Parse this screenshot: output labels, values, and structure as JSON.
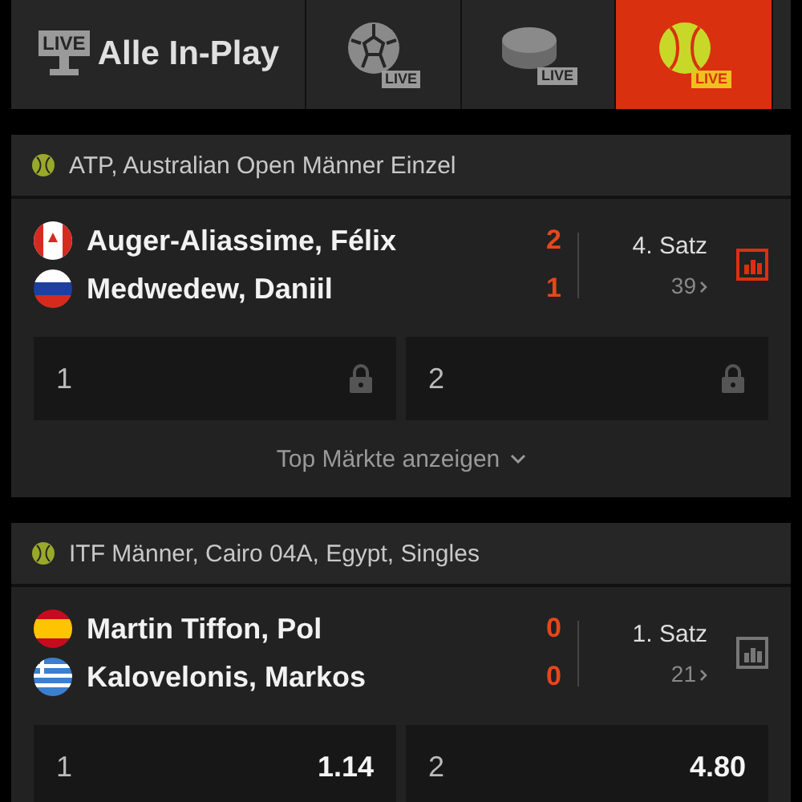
{
  "tabs": [
    {
      "kind": "all",
      "label": "Alle In-Play",
      "badge": "LIVE",
      "selected": false
    },
    {
      "kind": "soccer",
      "badge": "LIVE",
      "selected": false
    },
    {
      "kind": "hockey",
      "badge": "LIVE",
      "selected": false
    },
    {
      "kind": "tennis",
      "badge": "LIVE",
      "selected": true
    }
  ],
  "competitions": [
    {
      "title": "ATP, Australian Open Männer Einzel",
      "match": {
        "players": [
          {
            "kind": "ca",
            "name": "Auger-Aliassime, Félix",
            "score": "2"
          },
          {
            "kind": "ru",
            "name": "Medwedew, Daniil",
            "score": "1"
          }
        ],
        "period": "4. Satz",
        "markets": "39",
        "stats_highlighted": true,
        "odds": [
          {
            "label": "1",
            "locked": true
          },
          {
            "label": "2",
            "locked": true
          }
        ],
        "more": "Top Märkte anzeigen"
      }
    },
    {
      "title": "ITF Männer, Cairo 04A, Egypt, Singles",
      "match": {
        "players": [
          {
            "kind": "es",
            "name": "Martin Tiffon, Pol",
            "score": "0"
          },
          {
            "kind": "gr",
            "name": "Kalovelonis, Markos",
            "score": "0"
          }
        ],
        "period": "1. Satz",
        "markets": "21",
        "stats_highlighted": false,
        "odds": [
          {
            "label": "1",
            "locked": false,
            "price": "1.14"
          },
          {
            "label": "2",
            "locked": false,
            "price": "4.80"
          }
        ]
      }
    }
  ]
}
